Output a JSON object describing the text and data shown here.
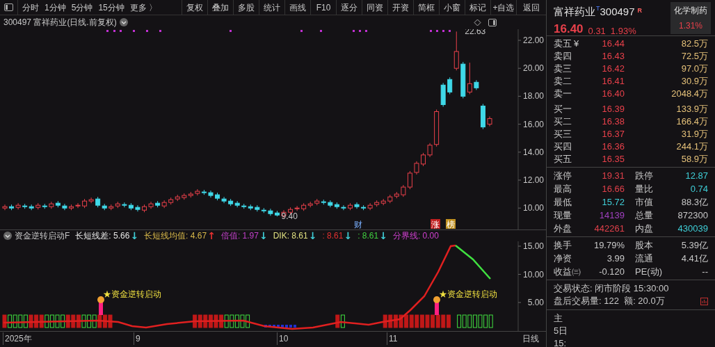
{
  "toolbar": {
    "periods": [
      "分时",
      "1分钟",
      "5分钟",
      "15分钟",
      "更多 〉"
    ],
    "buttons": [
      "复权",
      "叠加",
      "多股",
      "统计",
      "画线",
      "F10",
      "逐分",
      "同资",
      "开资",
      "简框",
      "小窗",
      "标记",
      "+自选"
    ],
    "back": "返回"
  },
  "chart": {
    "title": "300497 富祥药业(日线.前复权)",
    "price_ticks": [
      "22.00",
      "20.00",
      "18.00",
      "16.00",
      "14.00",
      "12.00",
      "10.00"
    ],
    "high_label": "22.63",
    "low_label": "9.40",
    "events": [
      {
        "text": "财",
        "kind": "finance"
      },
      {
        "text": "涨",
        "kind": "limit"
      },
      {
        "text": "榜",
        "kind": "list"
      }
    ]
  },
  "indicator": {
    "name": "资金逆转启动F",
    "items": [
      {
        "kind": "value",
        "text": "长短线差: 5.66",
        "color": "#e8e8e8"
      },
      {
        "kind": "arrow",
        "text": "↓",
        "color": "#3fcfd8"
      },
      {
        "kind": "value",
        "text": "长短线均值: 4.67",
        "color": "#d8b84a"
      },
      {
        "kind": "arrow",
        "text": "↑",
        "color": "#e83030"
      },
      {
        "kind": "value",
        "text": "倍值: 1.97",
        "color": "#c040c8"
      },
      {
        "kind": "arrow",
        "text": "↓",
        "color": "#3fcfd8"
      },
      {
        "kind": "value",
        "text": "DIK: 8.61",
        "color": "#e0e080"
      },
      {
        "kind": "arrow",
        "text": "↓",
        "color": "#3fcfd8"
      },
      {
        "kind": "value",
        "text": ": 8.61",
        "color": "#e03030"
      },
      {
        "kind": "arrow",
        "text": "↓",
        "color": "#3fcfd8"
      },
      {
        "kind": "value",
        "text": ": 8.61",
        "color": "#40d040"
      },
      {
        "kind": "arrow",
        "text": "↓",
        "color": "#3fcfd8"
      },
      {
        "kind": "value",
        "text": "分界线: 0.00",
        "color": "#d040d0"
      }
    ],
    "signals": [
      "★资金逆转启动",
      "★资金逆转启动"
    ],
    "ticks": [
      "15.00",
      "10.00",
      "5.00"
    ]
  },
  "x_axis": {
    "labels": [
      "2025年",
      "9",
      "10",
      "11"
    ],
    "period": "日线"
  },
  "quote": {
    "name": "富祥药业",
    "tag": "T",
    "code": "300497",
    "flag": "R",
    "sector": "化学制药",
    "sector_pct": "1.31%",
    "price": "16.40",
    "change": "0.31",
    "pct": "1.93%",
    "asks": [
      {
        "label": "卖五",
        "extra": "¥",
        "price": "16.44",
        "volume": "82.5万"
      },
      {
        "label": "卖四",
        "price": "16.43",
        "volume": "72.5万"
      },
      {
        "label": "卖三",
        "price": "16.42",
        "volume": "97.0万"
      },
      {
        "label": "卖二",
        "price": "16.41",
        "volume": "30.9万"
      },
      {
        "label": "卖一",
        "price": "16.40",
        "volume": "2048.4万"
      }
    ],
    "bids": [
      {
        "label": "买一",
        "price": "16.39",
        "volume": "133.9万"
      },
      {
        "label": "买二",
        "price": "16.38",
        "volume": "166.4万"
      },
      {
        "label": "买三",
        "price": "16.37",
        "volume": "31.9万"
      },
      {
        "label": "买四",
        "price": "16.36",
        "volume": "244.1万"
      },
      {
        "label": "买五",
        "price": "16.35",
        "volume": "58.9万"
      }
    ],
    "stats": [
      [
        {
          "label": "涨停",
          "value": "19.31",
          "color": "#e0404a"
        },
        {
          "label": "跌停",
          "value": "12.87",
          "color": "#3fcfd8"
        }
      ],
      [
        {
          "label": "最高",
          "value": "16.66",
          "color": "#e0404a"
        },
        {
          "label": "量比",
          "value": "0.74",
          "color": "#3fcfd8"
        }
      ],
      [
        {
          "label": "最低",
          "value": "15.72",
          "color": "#3fcfd8"
        },
        {
          "label": "市值",
          "value": "88.3亿",
          "color": "#c8c8c8"
        }
      ],
      [
        {
          "label": "现量",
          "value": "14139",
          "color": "#a040c0"
        },
        {
          "label": "总量",
          "value": "872300",
          "color": "#c8c8c8"
        }
      ],
      [
        {
          "label": "外盘",
          "value": "442261",
          "color": "#e0404a"
        },
        {
          "label": "内盘",
          "value": "430039",
          "color": "#3fcfd8"
        }
      ]
    ],
    "finance": [
      [
        {
          "label": "换手",
          "value": "19.79%"
        },
        {
          "label": "股本",
          "value": "5.39亿"
        }
      ],
      [
        {
          "label": "净资",
          "value": "3.99"
        },
        {
          "label": "流通",
          "value": "4.41亿"
        }
      ],
      [
        {
          "label": "收益㈢",
          "value": "-0.120"
        },
        {
          "label": "PE(动)",
          "value": "--"
        }
      ]
    ],
    "status": [
      "交易状态: 闭市阶段 15:30:00",
      "盘后交易量: 122  额: 20.0万"
    ],
    "more_rows": [
      "主",
      "5日",
      "15:"
    ]
  }
}
